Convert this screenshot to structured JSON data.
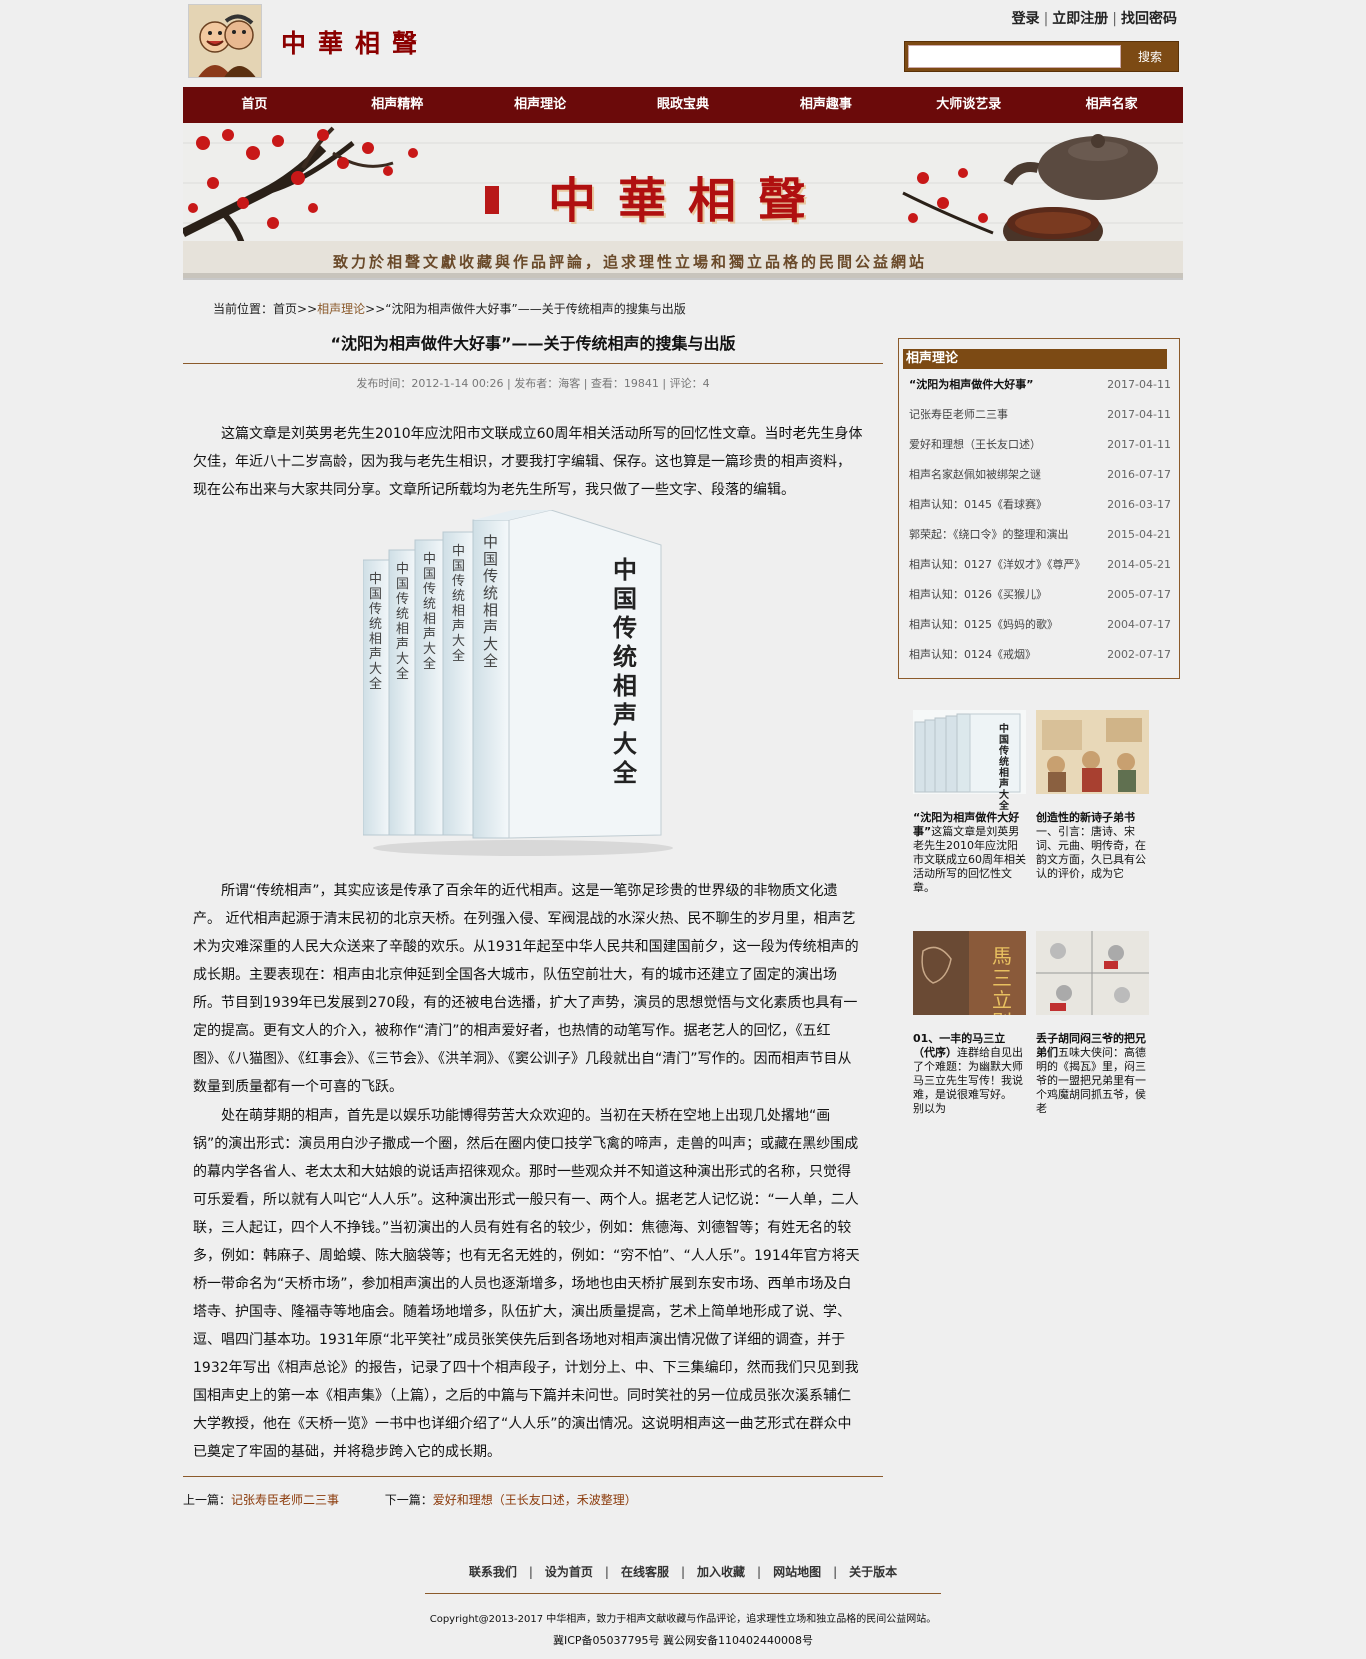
{
  "header": {
    "brand": "中華相聲",
    "login": "登录",
    "register": "立即注册",
    "recover": "找回密码",
    "search_button": "搜索",
    "search_value": ""
  },
  "nav": [
    "首页",
    "相声精粹",
    "相声理论",
    "眼政宝典",
    "相声趣事",
    "大师谈艺录",
    "相声名家"
  ],
  "banner": {
    "title": "中華相聲",
    "slogan": "致力於相聲文獻收藏與作品評論，追求理性立場和獨立品格的民間公益網站"
  },
  "breadcrumb": {
    "prefix": "当前位置：",
    "home": "首页",
    "sep": ">>",
    "category": "相声理论",
    "current": "“沈阳为相声做件大好事”——关于传统相声的搜集与出版"
  },
  "article": {
    "title": "“沈阳为相声做件大好事”——关于传统相声的搜集与出版",
    "meta": "发布时间：2012-1-14 00:26 | 发布者：海客 | 查看：19841 | 评论：4",
    "p1": "这篇文章是刘英男老先生2010年应沈阳市文联成立60周年相关活动所写的回忆性文章。当时老先生身体欠佳，年近八十二岁高龄，因为我与老先生相识，才要我打字编辑、保存。这也算是一篇珍贵的相声资料，现在公布出来与大家共同分享。文章所记所载均为老先生所写，我只做了一些文字、段落的编辑。",
    "book_titles": [
      "中国传统相声大全",
      "中国传统相声大全",
      "中国传统相声大全",
      "中国传统相声大全",
      "中国传统相声大全"
    ],
    "book_front_title": "中国传统相声大全",
    "p2": "所谓“传统相声”，其实应该是传承了百余年的近代相声。这是一笔弥足珍贵的世界级的非物质文化遗产。 近代相声起源于清末民初的北京天桥。在列强入侵、军阀混战的水深火热、民不聊生的岁月里，相声艺术为灾难深重的人民大众送来了辛酸的欢乐。从1931年起至中华人民共和国建国前夕，这一段为传统相声的成长期。主要表现在：相声由北京伸延到全国各大城市，队伍空前壮大，有的城市还建立了固定的演出场所。节目到1939年已发展到270段，有的还被电台选播，扩大了声势，演员的思想觉悟与文化素质也具有一定的提高。更有文人的介入，被称作“清门”的相声爱好者，也热情的动笔写作。据老艺人的回忆，《五红图》、《八猫图》、《红事会》、《三节会》、《洪羊洞》、《窦公训子》几段就出自“清门”写作的。因而相声节目从数量到质量都有一个可喜的飞跃。",
    "p3": "处在萌芽期的相声，首先是以娱乐功能博得劳苦大众欢迎的。当初在天桥在空地上出现几处撂地“画锅”的演出形式：演员用白沙子撒成一个圈，然后在圈内使口技学飞禽的啼声，走兽的叫声；或藏在黑纱围成的幕内学各省人、老太太和大姑娘的说话声招徕观众。那时一些观众并不知道这种演出形式的名称，只觉得可乐爱看，所以就有人叫它“人人乐”。这种演出形式一般只有一、两个人。据老艺人记忆说：“一人单，二人联，三人起讧，四个人不挣钱。”当初演出的人员有姓有名的较少，例如：焦德海、刘德智等；有姓无名的较多，例如：韩麻子、周蛤蟆、陈大脑袋等；也有无名无姓的，例如：“穷不怕”、“人人乐”。1914年官方将天桥一带命名为“天桥市场”，参加相声演出的人员也逐渐增多，场地也由天桥扩展到东安市场、西单市场及白塔寺、护国寺、隆福寺等地庙会。随着场地增多，队伍扩大，演出质量提高，艺术上简单地形成了说、学、逗、唱四门基本功。1931年原“北平笑社”成员张笑侠先后到各场地对相声演出情况做了详细的调查，并于1932年写出《相声总论》的报告，记录了四十个相声段子，计划分上、中、下三集编印，然而我们只见到我国相声史上的第一本《相声集》（上篇），之后的中篇与下篇并未问世。同时笑社的另一位成员张次溪系辅仁大学教授，他在《天桥一览》一书中也详细介绍了“人人乐”的演出情况。这说明相声这一曲艺形式在群众中已奠定了牢固的基础，并将稳步跨入它的成长期。",
    "prev_label": "上一篇：",
    "prev_title": "记张寿臣老师二三事",
    "next_label": "下一篇：",
    "next_title": "爱好和理想（王长友口述，禾波整理）"
  },
  "sidebar": {
    "title": "相声理论",
    "items": [
      {
        "title": "“沈阳为相声做件大好事”",
        "date": "2017-04-11"
      },
      {
        "title": "记张寿臣老师二三事",
        "date": "2017-04-11"
      },
      {
        "title": "爱好和理想（王长友口述）",
        "date": "2017-01-11"
      },
      {
        "title": "相声名家赵佩如被绑架之谜",
        "date": "2016-07-17"
      },
      {
        "title": "相声认知：0145《看球赛》",
        "date": "2016-03-17"
      },
      {
        "title": "郭荣起：《绕口令》的整理和演出",
        "date": "2015-04-21"
      },
      {
        "title": "相声认知：0127《洋奴才》《尊严》",
        "date": "2014-05-21"
      },
      {
        "title": "相声认知：0126《买猴儿》",
        "date": "2005-07-17"
      },
      {
        "title": "相声认知：0125《妈妈的歌》",
        "date": "2004-07-17"
      },
      {
        "title": "相声认知：0124《戒烟》",
        "date": "2002-07-17"
      }
    ]
  },
  "thumbs": [
    {
      "title": "“沈阳为相声做件大好事”",
      "text": "这篇文章是刘英男老先生2010年应沈阳市文联成立60周年相关活动所写的回忆性文章。"
    },
    {
      "title": "创造性的新诗子弟书",
      "text": "一、引言：唐诗、宋词、元曲、明传奇，在韵文方面，久已具有公认的评价，成为它"
    },
    {
      "title": "01、一丰的马三立（代序）",
      "text": "连群给自见出了个难题：为幽默大师马三立先生写传！我说难，是说很难写好。 别以为"
    },
    {
      "title": "丢子胡同闷三爷的把兄弟们",
      "text": "五味大侠问：高德明的《揭瓦》里，闷三爷的一盟把兄弟里有一个鸡魔胡同抓五爷，侯老"
    }
  ],
  "thumb_images": {
    "book_cover": "中国传统相声大全",
    "ma_cover": "馬三立别传"
  },
  "footer": {
    "links": [
      "联系我们",
      "设为首页",
      "在线客服",
      "加入收藏",
      "网站地图",
      "关于版本"
    ],
    "copyright": "Copyright@2013-2017 中华相声，致力于相声文献收藏与作品评论，追求理性立场和独立品格的民间公益网站。",
    "icp": "冀ICP备05037795号 冀公网安备110402440008号"
  }
}
